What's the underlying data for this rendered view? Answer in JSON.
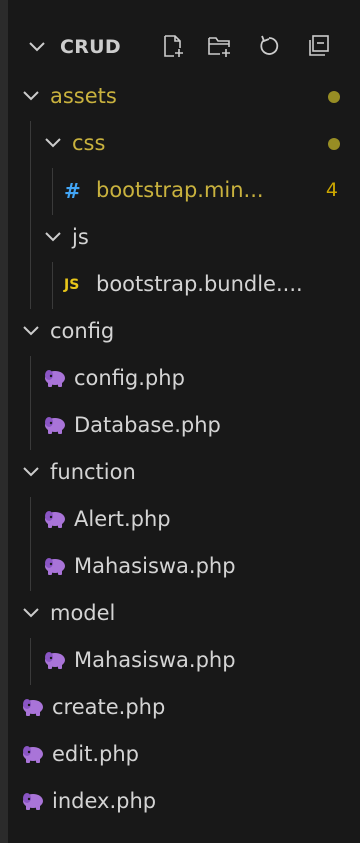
{
  "explorer": {
    "root_label": "CRUD",
    "actions": [
      {
        "name": "new-file"
      },
      {
        "name": "new-folder"
      },
      {
        "name": "refresh"
      },
      {
        "name": "collapse-all"
      }
    ]
  },
  "colors": {
    "background": "#181818",
    "text": "#d4d4d4",
    "modified": "#c9b23e",
    "modified_dot": "#978d24",
    "php_icon": "#a974d8",
    "css_icon": "#42a5f5",
    "js_icon": "#e8c61a"
  },
  "tree": [
    {
      "type": "folder",
      "label": "assets",
      "depth": 1,
      "expanded": true,
      "modified": true,
      "badge_dot": true
    },
    {
      "type": "folder",
      "label": "css",
      "depth": 2,
      "expanded": true,
      "modified": true,
      "badge_dot": true
    },
    {
      "type": "file",
      "icon": "css-hash-icon",
      "label": "bootstrap.min...",
      "depth": 3,
      "modified": true,
      "badge_count": "4"
    },
    {
      "type": "folder",
      "label": "js",
      "depth": 2,
      "expanded": true
    },
    {
      "type": "file",
      "icon": "js-icon",
      "label": "bootstrap.bundle....",
      "depth": 3
    },
    {
      "type": "folder",
      "label": "config",
      "depth": 1,
      "expanded": true
    },
    {
      "type": "file",
      "icon": "php-elephant-icon",
      "label": "config.php",
      "depth": 2
    },
    {
      "type": "file",
      "icon": "php-elephant-icon",
      "label": "Database.php",
      "depth": 2
    },
    {
      "type": "folder",
      "label": "function",
      "depth": 1,
      "expanded": true
    },
    {
      "type": "file",
      "icon": "php-elephant-icon",
      "label": "Alert.php",
      "depth": 2
    },
    {
      "type": "file",
      "icon": "php-elephant-icon",
      "label": "Mahasiswa.php",
      "depth": 2
    },
    {
      "type": "folder",
      "label": "model",
      "depth": 1,
      "expanded": true
    },
    {
      "type": "file",
      "icon": "php-elephant-icon",
      "label": "Mahasiswa.php",
      "depth": 2
    },
    {
      "type": "file",
      "icon": "php-elephant-icon",
      "label": "create.php",
      "depth": 1
    },
    {
      "type": "file",
      "icon": "php-elephant-icon",
      "label": "edit.php",
      "depth": 1
    },
    {
      "type": "file",
      "icon": "php-elephant-icon",
      "label": "index.php",
      "depth": 1
    }
  ]
}
